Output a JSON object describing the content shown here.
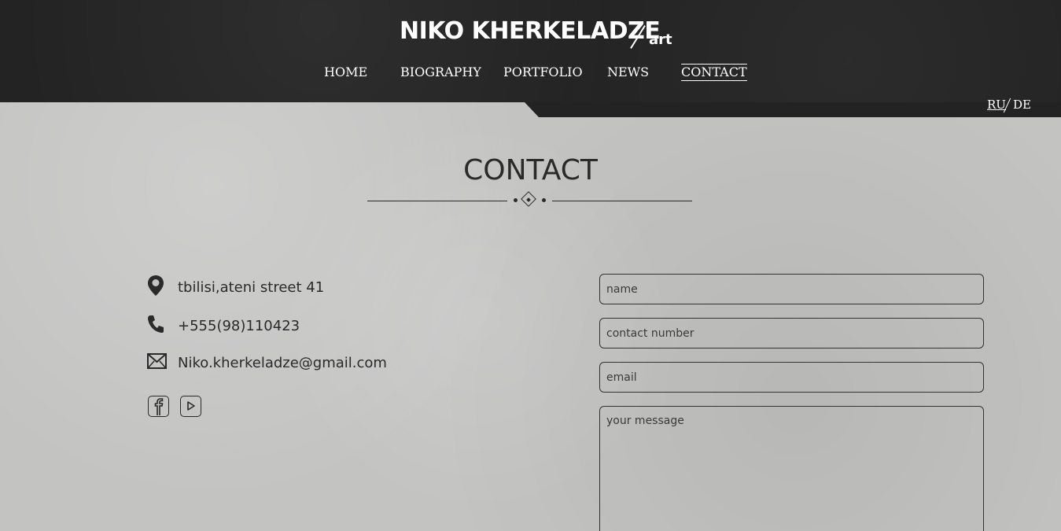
{
  "header": {
    "brand_name": "NIKO KHERKELADZE",
    "brand_suffix": "art"
  },
  "nav": {
    "items": [
      {
        "label": "HOME"
      },
      {
        "label": "BIOGRAPHY"
      },
      {
        "label": "PORTFOLIO"
      },
      {
        "label": "NEWS"
      },
      {
        "label": "CONTACT",
        "active": true
      }
    ]
  },
  "language": {
    "ru": "RU",
    "de": "DE"
  },
  "page": {
    "title": "CONTACT"
  },
  "contact": {
    "address": "tbilisi,ateni street 41",
    "phone": "+555(98)110423",
    "email": "Niko.kherkeladze@gmail.com",
    "social": [
      {
        "icon": "facebook-icon"
      },
      {
        "icon": "youtube-icon"
      }
    ]
  },
  "form": {
    "name_placeholder": "name",
    "contact_number_placeholder": "contact number",
    "email_placeholder": "email",
    "message_placeholder": "your message"
  },
  "colors": {
    "header_bg": "#232323",
    "page_bg": "#c3c3c2",
    "text_dark": "#2a2a2a",
    "text_light": "#ffffff"
  }
}
